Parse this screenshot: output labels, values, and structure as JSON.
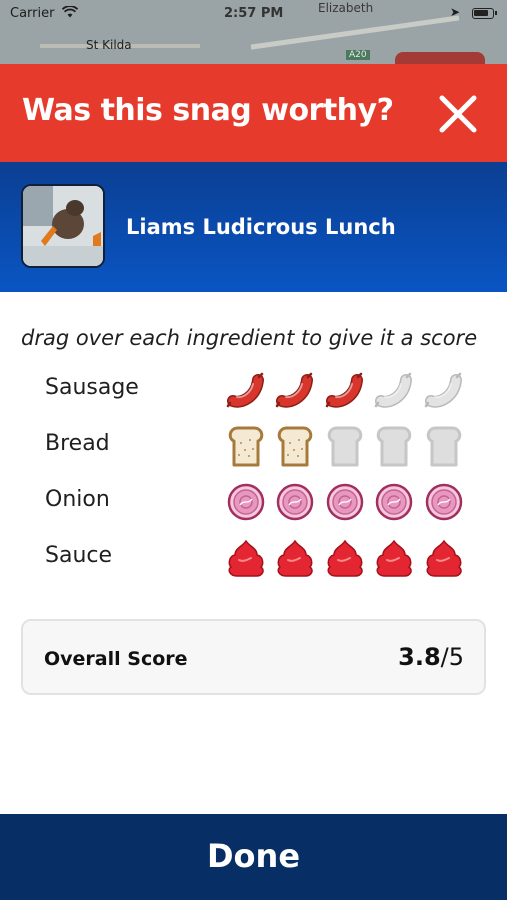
{
  "status_bar": {
    "carrier": "Carrier",
    "time": "2:57 PM"
  },
  "map": {
    "labels": [
      "St Kilda",
      "Elizabeth",
      "A20"
    ]
  },
  "header": {
    "title": "Was this snag worthy?",
    "close_icon": "close-x-icon",
    "background": "#e53a2c"
  },
  "meal": {
    "name": "Liams Ludicrous Lunch"
  },
  "instructions": "drag over each ingredient to give it a score",
  "ratings": [
    {
      "label": "Sausage",
      "icon": "sausage-icon",
      "score": 3,
      "max": 5
    },
    {
      "label": "Bread",
      "icon": "bread-icon",
      "score": 2,
      "max": 5
    },
    {
      "label": "Onion",
      "icon": "onion-icon",
      "score": 5,
      "max": 5
    },
    {
      "label": "Sauce",
      "icon": "sauce-icon",
      "score": 5,
      "max": 5
    }
  ],
  "overall": {
    "label": "Overall Score",
    "score": "3.8",
    "out_of": "/5"
  },
  "done_label": "Done",
  "colors": {
    "accent_red": "#e53a2c",
    "blue": "#0a4fb4",
    "done_navy": "#072f66"
  }
}
